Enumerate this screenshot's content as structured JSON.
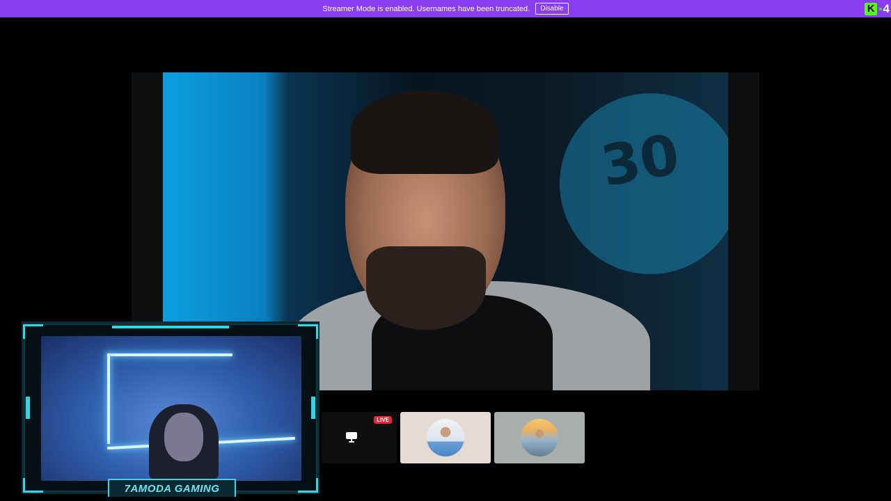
{
  "banner": {
    "message": "Streamer Mode is enabled. Usernames have been truncated.",
    "disable_label": "Disable",
    "background": "#8a3cf0"
  },
  "logo": {
    "letter": "K",
    "times": "×",
    "count": "4",
    "accent": "#53fc18"
  },
  "webcam": {
    "overlay_name": "7AMODA GAMING",
    "accent": "#2fd8e8"
  },
  "participants": {
    "screen_share": {
      "icon": "monitor-icon",
      "badge": "LIVE"
    },
    "avatars": [
      {
        "icon": "avatar-person-1"
      },
      {
        "icon": "avatar-person-2"
      }
    ]
  }
}
